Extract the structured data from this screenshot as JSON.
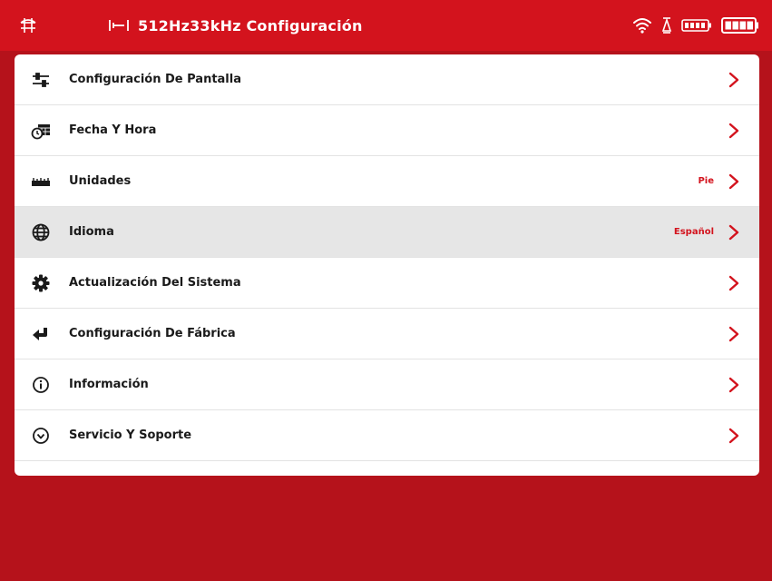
{
  "statusbar": {
    "title": "512Hz33kHz Configuración",
    "icons": [
      "grid-icon",
      "locator-icon",
      "wifi-icon",
      "bluetooth-icon",
      "receiver-battery-icon",
      "battery-icon"
    ]
  },
  "colors": {
    "accent": "#d3131d",
    "background": "#b5121b",
    "panel": "#ffffff",
    "selected_row": "#e6e6e6"
  },
  "menu": {
    "items": [
      {
        "label": "Configuración De Pantalla",
        "value": "",
        "icon": "sliders-icon"
      },
      {
        "label": "Fecha Y Hora",
        "value": "",
        "icon": "calendar-clock-icon"
      },
      {
        "label": "Unidades",
        "value": "Pie",
        "icon": "ruler-icon"
      },
      {
        "label": "Idioma",
        "value": "Español",
        "icon": "globe-icon",
        "selected": true
      },
      {
        "label": "Actualización Del Sistema",
        "value": "",
        "icon": "gear-icon"
      },
      {
        "label": "Configuración De Fábrica",
        "value": "",
        "icon": "reset-arrow-icon"
      },
      {
        "label": "Información",
        "value": "",
        "icon": "info-icon"
      },
      {
        "label": "Servicio Y Soporte",
        "value": "",
        "icon": "support-icon"
      }
    ]
  }
}
